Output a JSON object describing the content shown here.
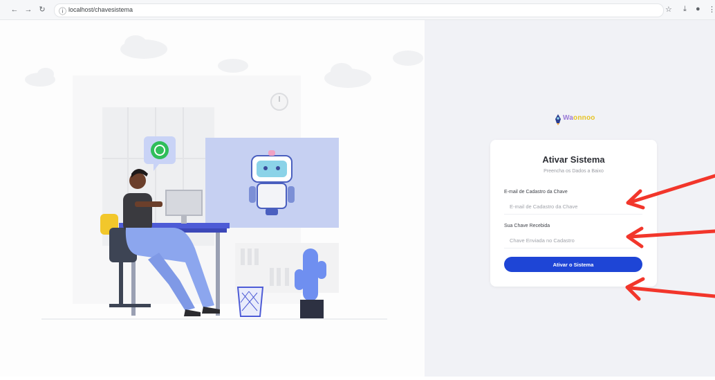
{
  "browser": {
    "url": "localhost/chavesistema",
    "icons": [
      "back-icon",
      "forward-icon",
      "reload-icon",
      "site-info-icon",
      "star-icon",
      "download-icon",
      "profile-icon",
      "menu-icon"
    ]
  },
  "logo": {
    "text_w": "Wa",
    "text_rest": "onnoo"
  },
  "form": {
    "title": "Ativar Sistema",
    "subtitle": "Preencha os Dados a Baixo",
    "email_label": "E-mail de Cadastro da Chave",
    "email_placeholder": "E-mail de Cadastro da Chave",
    "key_label": "Sua Chave Recebida",
    "key_placeholder": "Chave Enviada no Cadastro",
    "submit_label": "Ativar o Sistema"
  },
  "colors": {
    "accent": "#1e45d6",
    "annotation": "#f2362b",
    "panel": "#f1f2f6"
  }
}
